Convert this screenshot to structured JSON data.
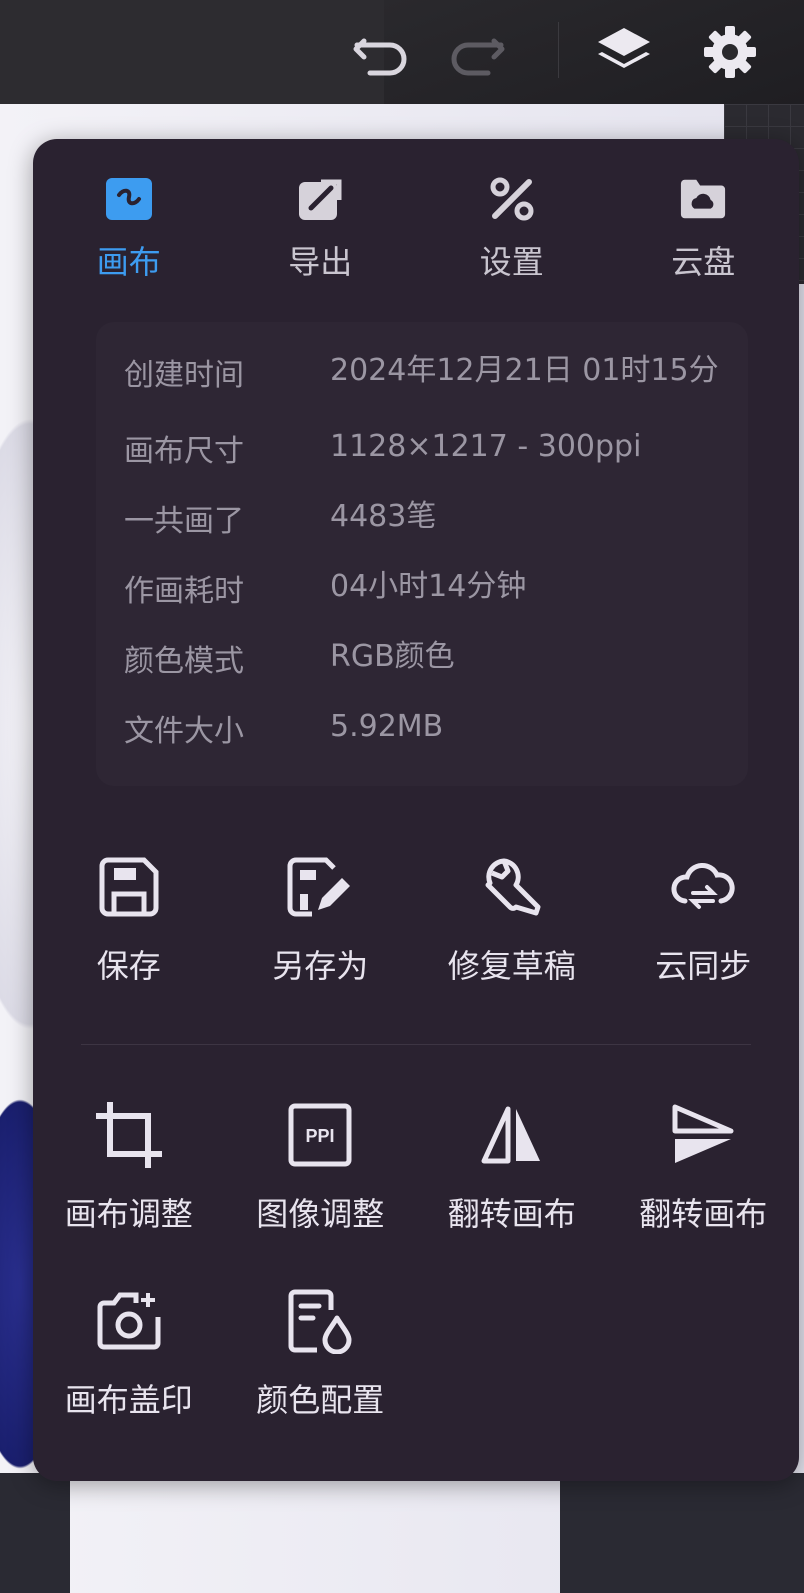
{
  "tabs": [
    {
      "label": "画布",
      "icon": "canvas-icon",
      "active": true
    },
    {
      "label": "导出",
      "icon": "export-icon",
      "active": false
    },
    {
      "label": "设置",
      "icon": "settings-tools-icon",
      "active": false
    },
    {
      "label": "云盘",
      "icon": "cloud-folder-icon",
      "active": false
    }
  ],
  "info": [
    {
      "key": "创建时间",
      "value": "2024年12月21日 01时15分"
    },
    {
      "key": "画布尺寸",
      "value": "1128×1217 - 300ppi"
    },
    {
      "key": "一共画了",
      "value": "4483笔"
    },
    {
      "key": "作画耗时",
      "value": "04小时14分钟"
    },
    {
      "key": "颜色模式",
      "value": "RGB颜色"
    },
    {
      "key": "文件大小",
      "value": "5.92MB"
    }
  ],
  "actions_row1": [
    {
      "label": "保存",
      "icon": "save-icon"
    },
    {
      "label": "另存为",
      "icon": "save-as-icon"
    },
    {
      "label": "修复草稿",
      "icon": "wrench-icon"
    },
    {
      "label": "云同步",
      "icon": "cloud-sync-icon"
    }
  ],
  "actions_row2": [
    {
      "label": "画布调整",
      "icon": "crop-icon"
    },
    {
      "label": "图像调整",
      "icon": "ppi-icon",
      "icon_text": "PPI"
    },
    {
      "label": "翻转画布",
      "icon": "flip-horizontal-icon"
    },
    {
      "label": "翻转画布",
      "icon": "flip-vertical-icon"
    }
  ],
  "actions_row3": [
    {
      "label": "画布盖印",
      "icon": "camera-icon"
    },
    {
      "label": "颜色配置",
      "icon": "color-profile-icon"
    }
  ],
  "colors": {
    "accent": "#3d9cf0",
    "panel": "#2a2230",
    "text": "#e8e4ee",
    "muted": "#9b96a3"
  }
}
